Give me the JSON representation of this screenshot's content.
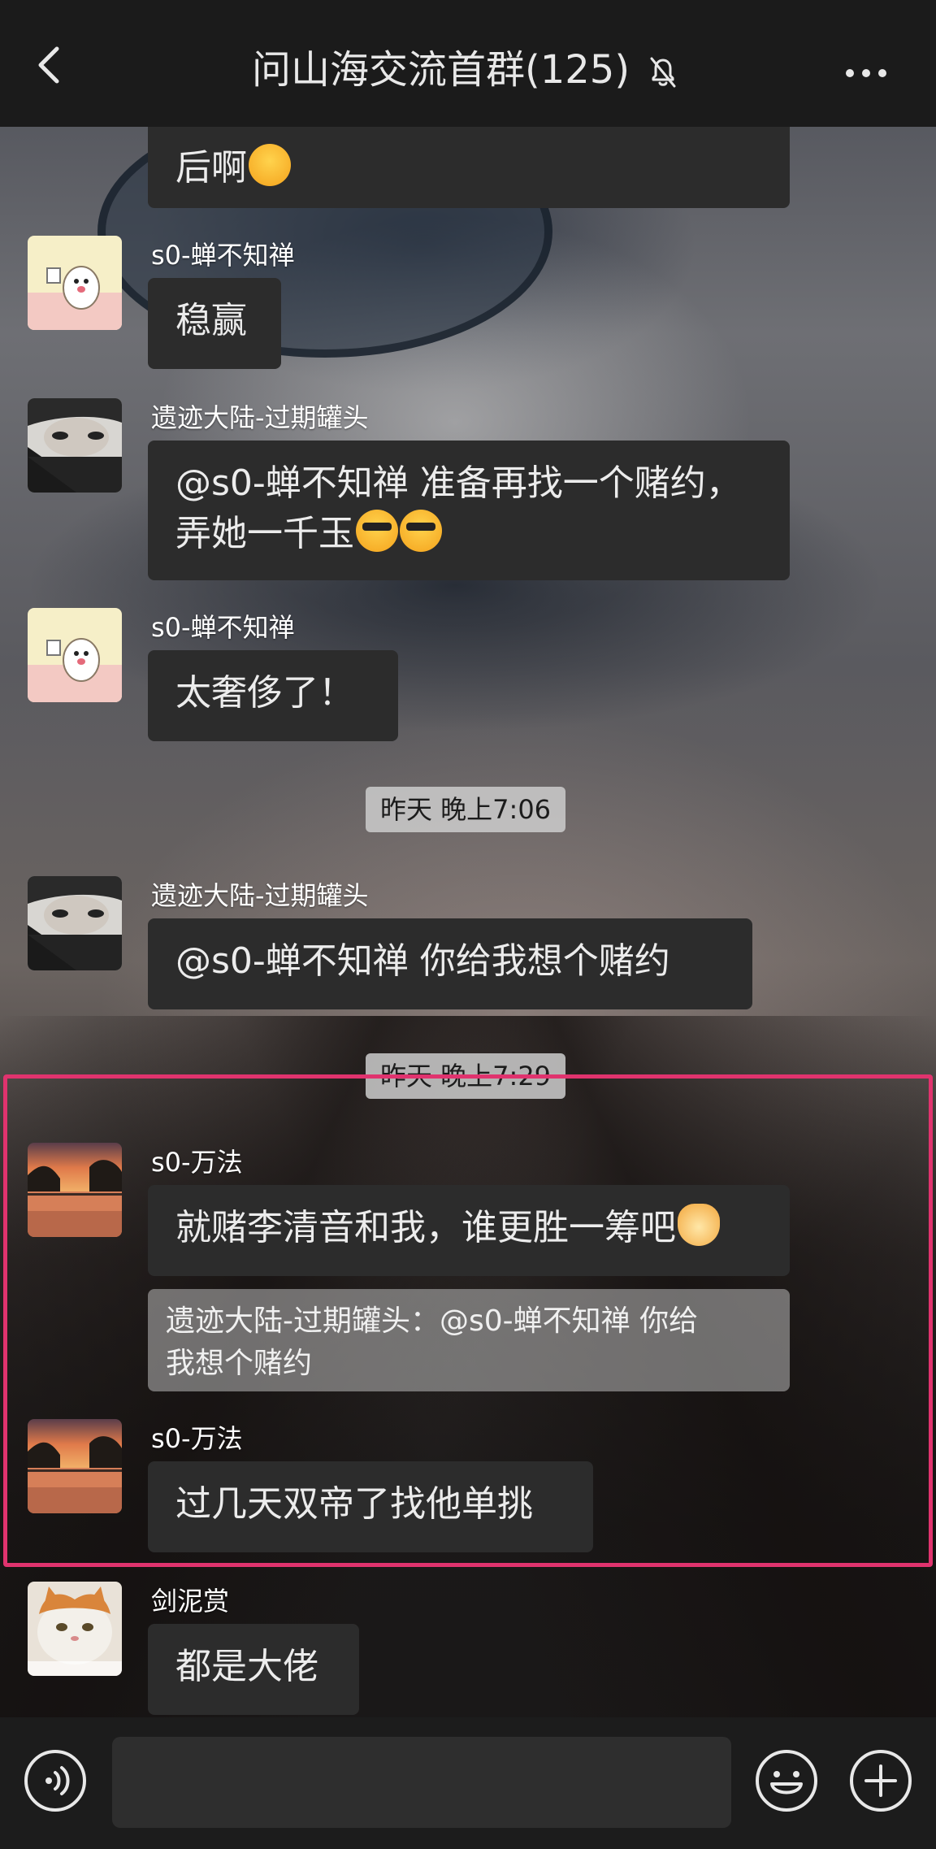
{
  "header": {
    "title": "问山海交流首群(125)",
    "back_icon": "chevron-left-icon",
    "mute_icon": "bell-off-icon",
    "more_icon": "more-dots-icon"
  },
  "messages": [
    {
      "type": "partial",
      "text": "后啊",
      "emoji": "smirk-face"
    },
    {
      "sender": "s0-蝉不知禅",
      "avatar": "hamster-avatar",
      "text": "稳赢"
    },
    {
      "sender": "遗迹大陆-过期罐头",
      "avatar": "man-portrait-avatar",
      "text_line1": "@s0-蝉不知禅  准备再找一个赌约，",
      "text_line2": "弄她一千玉",
      "emoji": "sunglasses-face"
    },
    {
      "sender": "s0-蝉不知禅",
      "avatar": "hamster-avatar",
      "text": "太奢侈了！"
    },
    {
      "sender": "遗迹大陆-过期罐头",
      "avatar": "man-portrait-avatar",
      "text": "@s0-蝉不知禅  你给我想个赌约"
    },
    {
      "sender": "s0-万法",
      "avatar": "sunset-lake-avatar",
      "text": "就赌李清音和我，谁更胜一筹吧",
      "emoji": "cat-face",
      "quote_line1": "遗迹大陆-过期罐头：@s0-蝉不知禅 你给",
      "quote_line2": "我想个赌约"
    },
    {
      "sender": "s0-万法",
      "avatar": "sunset-lake-avatar",
      "text": "过几天双帝了找他单挑"
    },
    {
      "sender": "剑泥赏",
      "avatar": "orange-cat-avatar",
      "text": "都是大佬"
    }
  ],
  "timestamps": [
    "昨天 晚上7:06",
    "昨天 晚上7:29"
  ],
  "input": {
    "placeholder": "",
    "voice_icon": "voice-input-icon",
    "emoji_icon": "emoji-smile-icon",
    "plus_icon": "plus-circle-icon"
  },
  "colors": {
    "highlight": "#e0336e",
    "bubble": "#2c2c2c",
    "header_bg": "#1b1b1b"
  }
}
